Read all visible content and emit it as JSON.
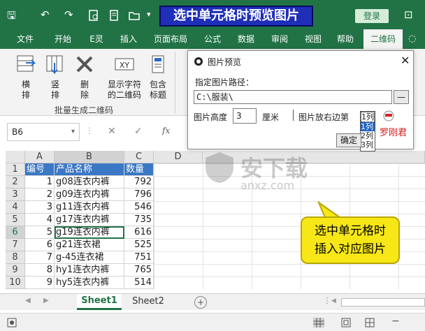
{
  "title_bar": {
    "banner": "选中单元格时预览图片",
    "login_label": "登录",
    "restore_glyph": "⊡",
    "qa_save": "🖫",
    "qa_undo": "↶",
    "qa_redo": "↷"
  },
  "tabs": [
    "文件",
    "开始",
    "E灵",
    "插入",
    "页面布局",
    "公式",
    "数据",
    "审阅",
    "视图",
    "帮助",
    "二维码"
  ],
  "ribbon": {
    "buttons": [
      {
        "label": "横\n排",
        "icon": "horizontal-layout-icon"
      },
      {
        "label": "竖\n排",
        "icon": "vertical-layout-icon"
      },
      {
        "label": "删\n除",
        "icon": "delete-icon"
      },
      {
        "label": "显示字符\n的二维码",
        "icon": "xy-qrcode-icon"
      },
      {
        "label": "包含\n标题",
        "icon": "title-icon"
      }
    ],
    "group_label": "批量生成二维码"
  },
  "formula_bar": {
    "name_box": "B6",
    "fx": "fx",
    "cancel": "✕",
    "confirm": "✓"
  },
  "columns": [
    "A",
    "B",
    "C",
    "D"
  ],
  "rows": [
    {
      "n": "1",
      "a": "编号",
      "b": "产品名称",
      "c": "数量"
    },
    {
      "n": "2",
      "a": "1",
      "b": "g08连衣内裤",
      "c": "792"
    },
    {
      "n": "3",
      "a": "2",
      "b": "g09连衣内裤",
      "c": "796"
    },
    {
      "n": "4",
      "a": "3",
      "b": "g11连衣内裤",
      "c": "546"
    },
    {
      "n": "5",
      "a": "4",
      "b": "g17连衣内裤",
      "c": "735"
    },
    {
      "n": "6",
      "a": "5",
      "b": "g19连衣内裤",
      "c": "616"
    },
    {
      "n": "7",
      "a": "6",
      "b": "g21连衣裙",
      "c": "525"
    },
    {
      "n": "8",
      "a": "7",
      "b": "g-45连衣裙",
      "c": "751"
    },
    {
      "n": "9",
      "a": "8",
      "b": "hy1连衣内裤",
      "c": "765"
    },
    {
      "n": "10",
      "a": "9",
      "b": "hy5连衣内裤",
      "c": "514"
    }
  ],
  "dialog": {
    "title": "图片预览",
    "path_label": "指定图片路径：",
    "path_value": "C:\\服装\\",
    "browse": "—",
    "height_label": "图片高度",
    "height_value": "3",
    "unit": "厘米",
    "edge_label": "图片放右边第",
    "edge_options": [
      "1列",
      "2列",
      "3列"
    ],
    "confirm": "确定",
    "watermark_name": "罗刚君"
  },
  "callout": {
    "line1": "选中单元格时",
    "line2": "插入对应图片"
  },
  "sheets": [
    "Sheet1",
    "Sheet2"
  ],
  "add_sheet": "+",
  "watermark": {
    "text": "安下载",
    "sub": "anxz.com"
  },
  "colors": {
    "excel_green": "#217346",
    "callout_yellow": "#f7e716",
    "banner_blue": "#1f2fb8"
  }
}
